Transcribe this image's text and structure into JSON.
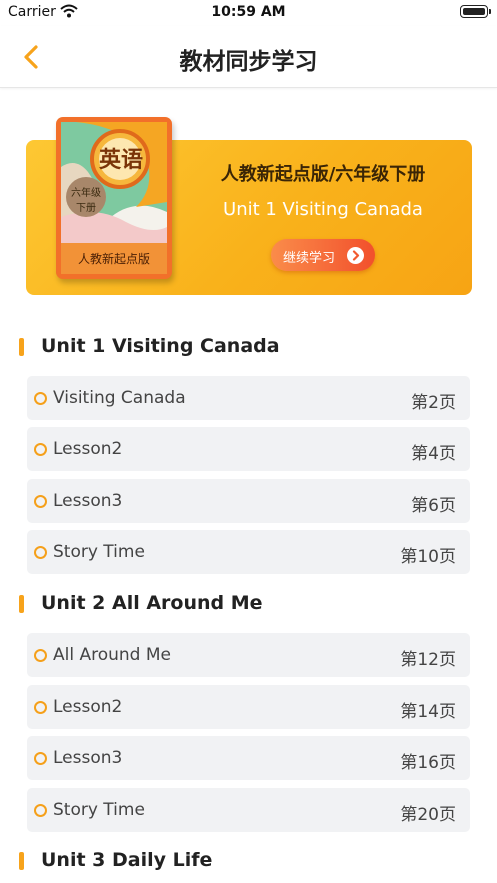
{
  "status_bar": {
    "carrier": "Carrier",
    "time": "10:59 AM"
  },
  "nav": {
    "title": "教材同步学习",
    "back_icon": "chevron-left-icon",
    "accent_color": "#F7A31B"
  },
  "banner": {
    "book_subject": "英语",
    "book_grade_line1": "六年级",
    "book_grade_line2": "下册",
    "book_edition": "人教新起点版",
    "title": "人教新起点版/六年级下册",
    "current_unit": "Unit 1 Visiting Canada",
    "continue_label": "继续学习",
    "continue_icon": "chevron-right-circle-icon"
  },
  "units": [
    {
      "title": "Unit 1 Visiting Canada",
      "lessons": [
        {
          "name": "Visiting Canada",
          "page": "第2页"
        },
        {
          "name": "Lesson2",
          "page": "第4页"
        },
        {
          "name": "Lesson3",
          "page": "第6页"
        },
        {
          "name": "Story Time",
          "page": "第10页"
        }
      ]
    },
    {
      "title": "Unit 2 All Around Me",
      "lessons": [
        {
          "name": "All Around Me",
          "page": "第12页"
        },
        {
          "name": "Lesson2",
          "page": "第14页"
        },
        {
          "name": "Lesson3",
          "page": "第16页"
        },
        {
          "name": "Story Time",
          "page": "第20页"
        }
      ]
    },
    {
      "title": "Unit 3 Daily Life",
      "lessons": []
    }
  ]
}
